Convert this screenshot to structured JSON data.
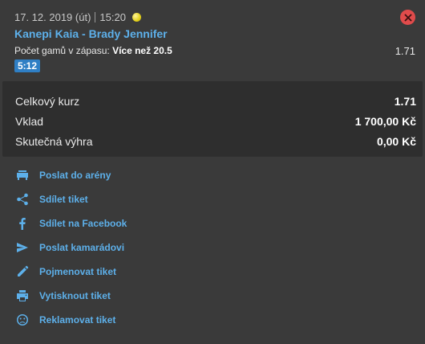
{
  "bet": {
    "date": "17. 12. 2019 (út)",
    "time": "15:20",
    "match": "Kanepi Kaia - Brady Jennifer",
    "market_label": "Počet gamů v zápasu:",
    "market_value": "Více než 20.5",
    "odds": "1.71",
    "score_badge": "5:12"
  },
  "summary": {
    "total_odds_label": "Celkový kurz",
    "total_odds_value": "1.71",
    "stake_label": "Vklad",
    "stake_value": "1 700,00 Kč",
    "payout_label": "Skutečná výhra",
    "payout_value": "0,00 Kč"
  },
  "actions": [
    {
      "label": "Poslat do arény",
      "icon": "arena-icon"
    },
    {
      "label": "Sdílet tiket",
      "icon": "share-icon"
    },
    {
      "label": "Sdílet na Facebook",
      "icon": "facebook-icon"
    },
    {
      "label": "Poslat kamarádovi",
      "icon": "send-icon"
    },
    {
      "label": "Pojmenovat tiket",
      "icon": "pencil-icon"
    },
    {
      "label": "Vytisknout tiket",
      "icon": "print-icon"
    },
    {
      "label": "Reklamovat tiket",
      "icon": "complaint-icon"
    }
  ],
  "colors": {
    "background": "#3a3a3a",
    "panel": "#2e2e2e",
    "link": "#5db0ea",
    "close": "#e04b4b",
    "badge": "#2f7fc5"
  }
}
